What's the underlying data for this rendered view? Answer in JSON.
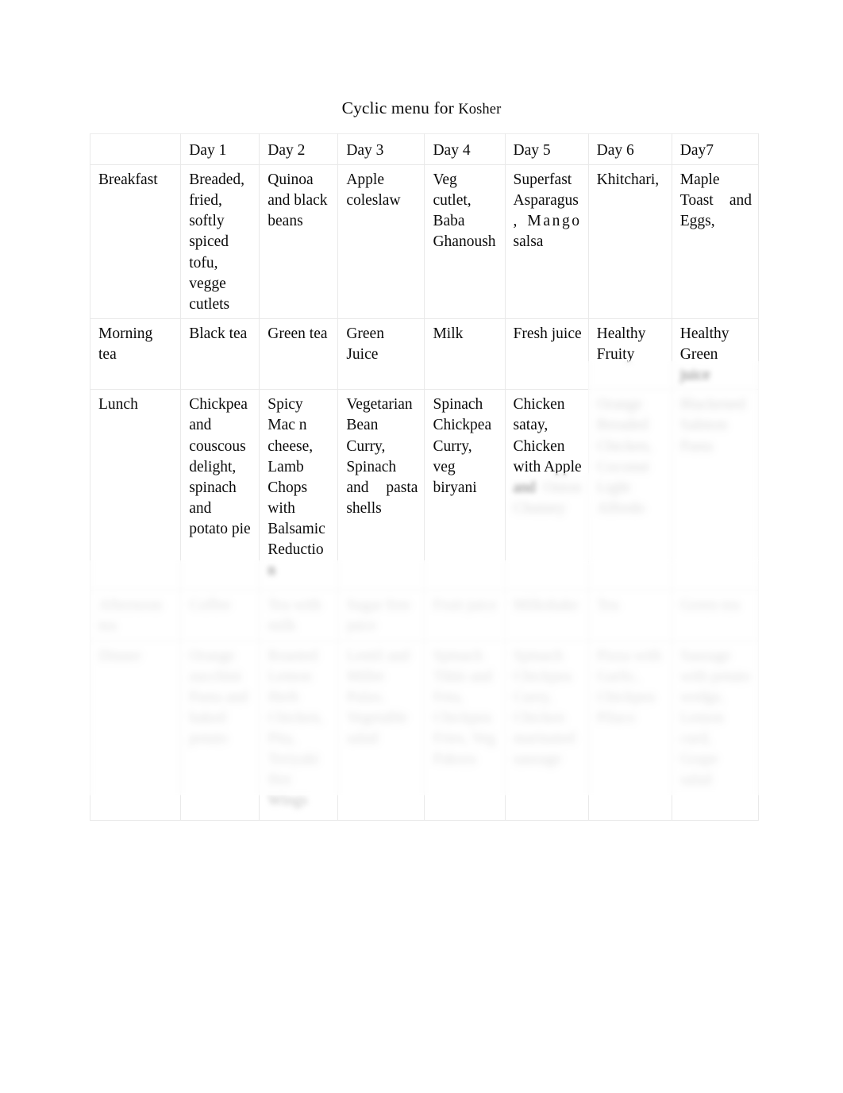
{
  "document": {
    "title_main": "Cyclic menu for ",
    "title_sub": "Kosher"
  },
  "table": {
    "row_header_label": "",
    "columns": [
      "Day 1",
      "Day 2",
      "Day 3",
      "Day 4",
      "Day 5",
      "Day 6",
      "Day7"
    ],
    "rows": [
      {
        "label": "Breakfast",
        "cells": [
          "Breaded, fried, softly spiced tofu, vegge cutlets",
          "Quinoa and black beans",
          "Apple coleslaw",
          "Veg cutlet, Baba Ghanoush",
          "Superfast Asparagus, ",
          "Khitchari,",
          "Maple Toast and Eggs,"
        ],
        "cell_day5_spread": "Mango",
        "cell_day5_tail": " salsa"
      },
      {
        "label": "Morning tea",
        "cells": [
          "Black tea",
          "Green tea",
          "Green Juice",
          "Milk",
          "Fresh juice",
          "Healthy Fruity",
          "Healthy Green juice"
        ]
      },
      {
        "label": "Lunch",
        "cells": [
          "Chickpea and couscous delight, spinach and potato pie",
          "Spicy Mac n cheese, Lamb Chops with Balsamic Reduction",
          "Vegetarian Bean Curry, Spinach and pasta shells",
          "Spinach Chickpea Curry, veg biryani",
          "Chicken satay, Chicken with Apple and",
          "",
          ""
        ],
        "cell_day5_redacted": "Onion Chutney",
        "cell_day6_redacted": "Orange Breaded Chicken, Coconut Light Alfredo",
        "cell_day7_redacted": "Blackened Salmon Pasta"
      },
      {
        "label": "",
        "label_redacted": "Afternoon tea",
        "cells": [
          "",
          "",
          "",
          "",
          "",
          "",
          ""
        ],
        "cells_redacted": [
          "Coffee",
          "Tea with milk",
          "Sugar free juice",
          "Fruit juice",
          "Milkshake",
          "Tea",
          "Green tea"
        ]
      },
      {
        "label": "",
        "label_redacted": "Dinner",
        "cells": [
          "",
          "",
          "",
          "",
          "",
          "",
          ""
        ],
        "cells_redacted": [
          "Orange zucchini Pasta and baked potato",
          "Roasted Lemon Herb Chicken, Pita, Teriyaki Hot Wings",
          "Lentil and Millet Pulav, Vegetable salad",
          "Spinach Tikki and Feta, Chickpea Fries, Veg Pakora",
          "Spinach Chickpea Curry, Chicken marinated sausage",
          "Pizza with Garlic, Chickpea Pilaco",
          "Sausage with potato wedge, Lemon curd, Grape salad"
        ]
      }
    ]
  }
}
